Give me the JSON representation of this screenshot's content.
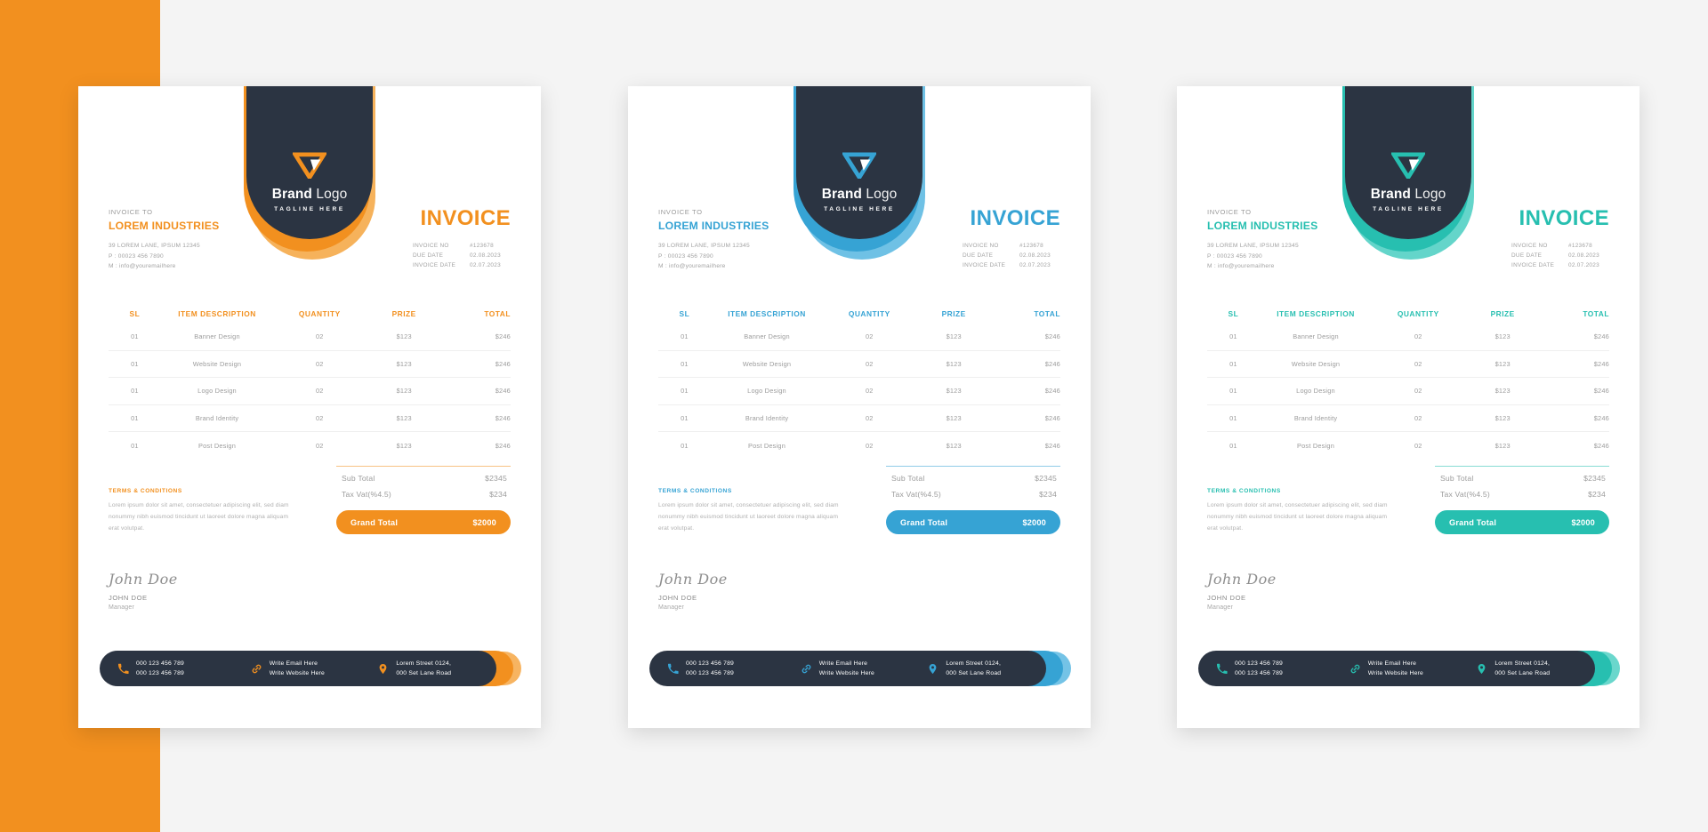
{
  "page": {
    "background": "#f4f4f4",
    "side_block_color": "#F2901F",
    "dark": "#2B3442"
  },
  "brand": {
    "name_bold": "Brand",
    "name_light": "Logo",
    "tagline": "TAGLINE HERE",
    "logo_icon": "angular-v-triangle-icon"
  },
  "labels": {
    "invoice_to_label": "INVOICE TO",
    "invoice_title": "INVOICE",
    "terms_title": "TERMS & CONDITIONS",
    "sub_total_label": "Sub Total",
    "tax_label": "Tax Vat(%4.5)",
    "grand_total_label": "Grand Total"
  },
  "client": {
    "name": "LOREM INDUSTRIES",
    "address": "39 LOREM LANE, IPSUM 12345",
    "phone": "P :  00023 456 7890",
    "mail": "M : info@youremailhere"
  },
  "meta_rows": [
    {
      "key": "INVOICE NO",
      "value": "#123678"
    },
    {
      "key": "DUE DATE",
      "value": "02.08.2023"
    },
    {
      "key": "INVOICE DATE",
      "value": "02.07.2023"
    }
  ],
  "table": {
    "headers": [
      "SL",
      "ITEM DESCRIPTION",
      "QUANTITY",
      "PRIZE",
      "TOTAL"
    ],
    "rows": [
      [
        "01",
        "Banner Design",
        "02",
        "$123",
        "$246"
      ],
      [
        "01",
        "Website Design",
        "02",
        "$123",
        "$246"
      ],
      [
        "01",
        "Logo Design",
        "02",
        "$123",
        "$246"
      ],
      [
        "01",
        "Brand Identity",
        "02",
        "$123",
        "$246"
      ],
      [
        "01",
        "Post Design",
        "02",
        "$123",
        "$246"
      ]
    ]
  },
  "totals": {
    "sub_total": "$2345",
    "tax": "$234",
    "grand_total": "$2000"
  },
  "terms_body": "Lorem ipsum dolor sit amet, consectetuer adipiscing elit, sed diam nonummy nibh euismod tincidunt ut laoreet dolore magna aliquam erat volutpat.",
  "signature": {
    "script": "John Doe",
    "name": "JOHN DOE",
    "role": "Manager"
  },
  "footer": {
    "phone_icon": "phone-icon",
    "link_icon": "link-icon",
    "location_icon": "location-pin-icon",
    "phone_1": "000 123 456 789",
    "phone_2": "000 123 456 789",
    "email": "Write Email Here",
    "website": "Write Website Here",
    "address_1": "Lorem Street 0124,",
    "address_2": "000 Set Lane Road"
  },
  "variants": [
    {
      "id": "orange",
      "accent": "#F2901F",
      "accent_soft": "#F5A43E"
    },
    {
      "id": "blue",
      "accent": "#36A3D4",
      "accent_soft": "#56B6E0"
    },
    {
      "id": "teal",
      "accent": "#27BFB0",
      "accent_soft": "#49CEC1"
    }
  ]
}
